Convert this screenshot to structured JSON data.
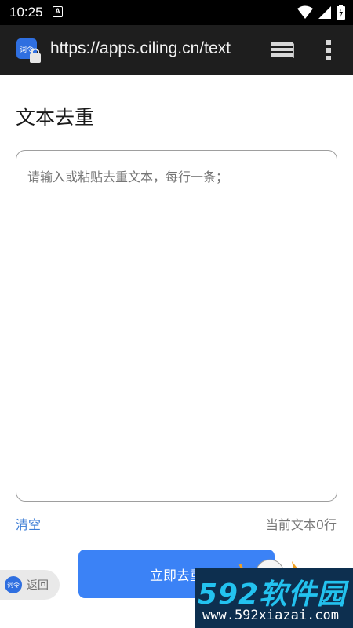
{
  "status_bar": {
    "time": "10:25",
    "notification_icon_letter": "A",
    "icons": [
      "wifi-icon",
      "cellular-signal-icon",
      "battery-icon"
    ]
  },
  "browser": {
    "url": "https://apps.ciling.cn/text",
    "app_icon_text": "词令",
    "icons": [
      "tabs-icon",
      "more-vert-icon"
    ]
  },
  "page": {
    "title": "文本去重",
    "textarea_placeholder": "请输入或粘贴去重文本，每行一条；",
    "textarea_value": "",
    "clear_label": "清空",
    "line_count": "当前文本0行",
    "primary_button_label": "立即去重"
  },
  "floating_back": {
    "badge_text": "词令",
    "label": "返回"
  },
  "watermark": {
    "brand": "592软件园",
    "url": "www.592xiazai.com"
  },
  "colors": {
    "accent": "#3b82f6",
    "link": "#3a7bd5",
    "toolbar": "#1e1e1e",
    "watermark_bg": "#0d2f4f",
    "watermark_text": "#23c2ef"
  }
}
